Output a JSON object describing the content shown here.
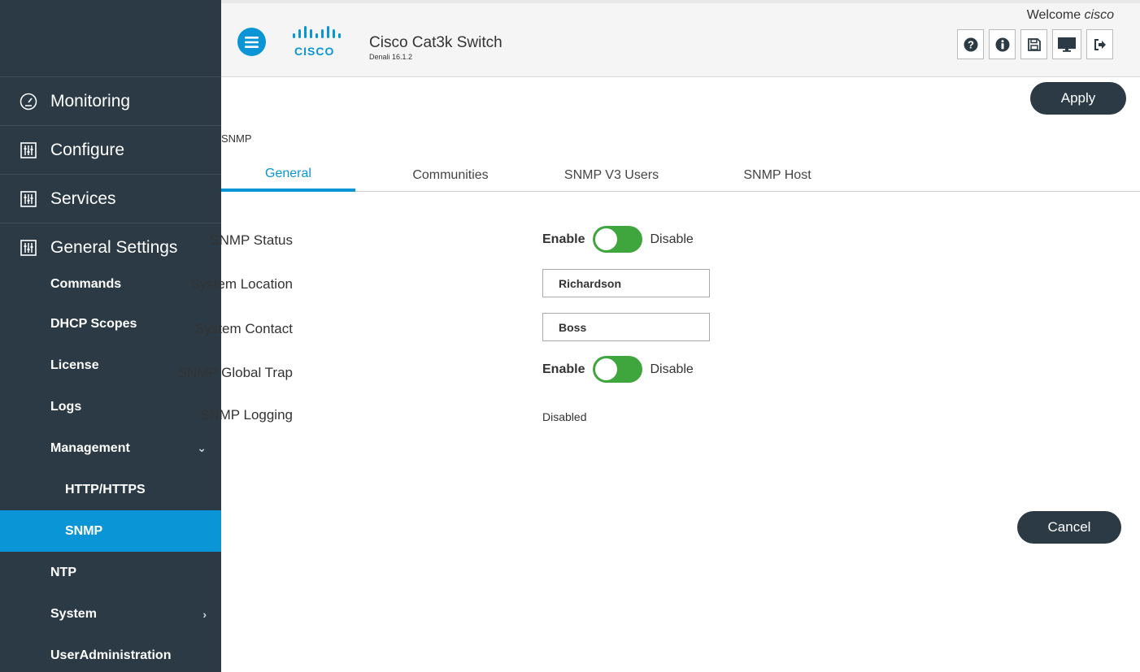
{
  "header": {
    "brand": "CISCO",
    "title": "Cisco Cat3k Switch",
    "version": "Denali 16.1.2",
    "welcome_prefix": "Welcome",
    "welcome_user": "cisco",
    "icons": [
      "help-icon",
      "info-icon",
      "save-icon",
      "monitor-icon",
      "logout-icon"
    ]
  },
  "sidebar": {
    "main": [
      {
        "label": "Monitoring",
        "icon": "dashboard-gauge-icon"
      },
      {
        "label": "Configure",
        "icon": "sliders-icon"
      },
      {
        "label": "Services",
        "icon": "sliders-icon"
      },
      {
        "label": "General Settings",
        "icon": "sliders-icon"
      }
    ],
    "sub": [
      {
        "label": "Commands"
      },
      {
        "label": "DHCP Scopes"
      },
      {
        "label": "License"
      },
      {
        "label": "Logs"
      },
      {
        "label": "Management",
        "chevron": "⌄"
      },
      {
        "label": "HTTP/HTTPS"
      },
      {
        "label": "SNMP"
      },
      {
        "label": "NTP"
      },
      {
        "label": "System",
        "chevron": "›"
      },
      {
        "label": "UserAdministration"
      }
    ]
  },
  "main": {
    "apply_label": "Apply",
    "cancel_label": "Cancel",
    "section_title": "SNMP",
    "tabs": [
      {
        "label": "General"
      },
      {
        "label": "Communities"
      },
      {
        "label": "SNMP V3 Users"
      },
      {
        "label": "SNMP Host"
      }
    ],
    "form": {
      "snmp_status": {
        "label": "SNMP Status",
        "on": "Enable",
        "off": "Disable"
      },
      "system_location": {
        "label": "System Location",
        "value": "Richardson"
      },
      "system_contact": {
        "label": "System Contact",
        "value": "Boss"
      },
      "global_trap": {
        "label": "SNMP Global Trap",
        "on": "Enable",
        "off": "Disable"
      },
      "logging": {
        "label": "SNMP Logging",
        "value": "Disabled"
      }
    }
  },
  "colors": {
    "sidebar_bg": "#2b3a44",
    "accent": "#0a96d6",
    "toggle_on": "#3ea63c"
  }
}
